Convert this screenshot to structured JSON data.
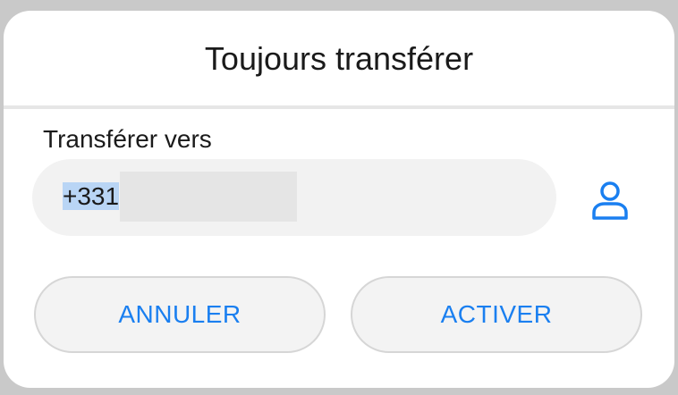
{
  "dialog": {
    "title": "Toujours transférer",
    "field_label": "Transférer vers",
    "number_value": "+331",
    "contact_icon": "person-icon",
    "cancel_label": "ANNULER",
    "activate_label": "ACTIVER"
  },
  "colors": {
    "accent": "#1a7ff0",
    "selection": "#b9d5f5"
  }
}
